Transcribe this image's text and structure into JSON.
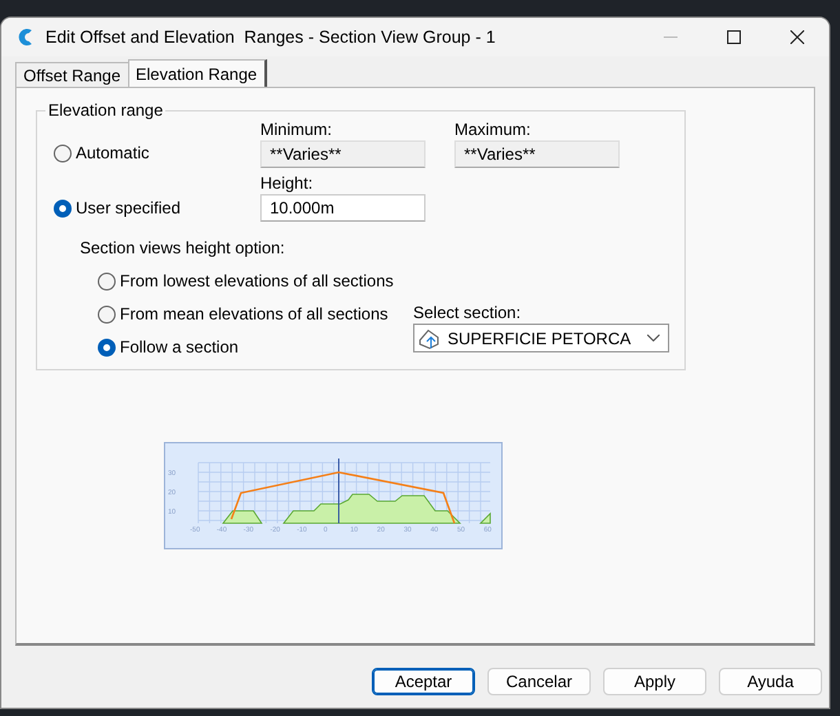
{
  "window": {
    "title": "Edit Offset and Elevation  Ranges - Section View Group - 1"
  },
  "tabs": [
    {
      "label": "Offset Range",
      "selected": false
    },
    {
      "label": "Elevation Range",
      "selected": true
    }
  ],
  "elevation_range": {
    "title": "Elevation range",
    "modes": [
      {
        "label": "Automatic",
        "selected": false
      },
      {
        "label": "User specified",
        "selected": true
      }
    ],
    "minimum": {
      "label": "Minimum:",
      "value": "**Varies**",
      "disabled": true
    },
    "maximum": {
      "label": "Maximum:",
      "value": "**Varies**",
      "disabled": true
    },
    "height": {
      "label": "Height:",
      "value": "10.000m",
      "disabled": false
    },
    "height_option_label": "Section views height option:",
    "height_options": [
      {
        "label": "From lowest elevations of all sections",
        "selected": false
      },
      {
        "label": "From mean elevations of all sections",
        "selected": false
      },
      {
        "label": "Follow a section",
        "selected": true
      }
    ],
    "select_section": {
      "label": "Select section:",
      "value": "SUPERFICIE PETORCA"
    }
  },
  "preview": {
    "x_labels": [
      "-50",
      "-40",
      "-30",
      "-20",
      "-10",
      "0",
      "10",
      "20",
      "30",
      "40",
      "50",
      "60"
    ],
    "y_labels": [
      "30",
      "20",
      "10"
    ]
  },
  "buttons": [
    {
      "label": "Aceptar",
      "default": true
    },
    {
      "label": "Cancelar",
      "default": false
    },
    {
      "label": "Apply",
      "default": false
    },
    {
      "label": "Ayuda",
      "default": false
    }
  ]
}
